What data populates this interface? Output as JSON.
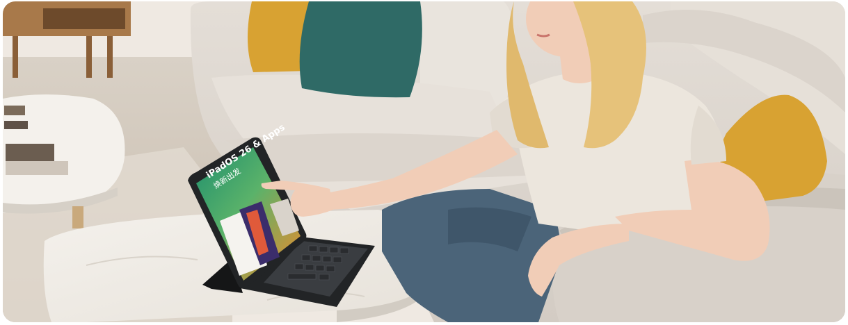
{
  "photo": {
    "subject": "woman-using-tablet-with-keyboard-on-sofa",
    "screen_text_line1": "iPadOS 26 & Apps",
    "screen_text_line2": "焕新出发"
  },
  "colors": {
    "wall": "#efe9e2",
    "sofa": "#dcd6cf",
    "sofa_shadow": "#c8c1b9",
    "pillow_teal": "#2f6a66",
    "pillow_mustard": "#d8a232",
    "table_marble": "#f2efea",
    "hair": "#e6c27a",
    "skin": "#f1cdb7",
    "shirt": "#ece6dd",
    "jeans": "#4b6479",
    "tablet_frame": "#222426",
    "keyboard": "#2f3134"
  }
}
